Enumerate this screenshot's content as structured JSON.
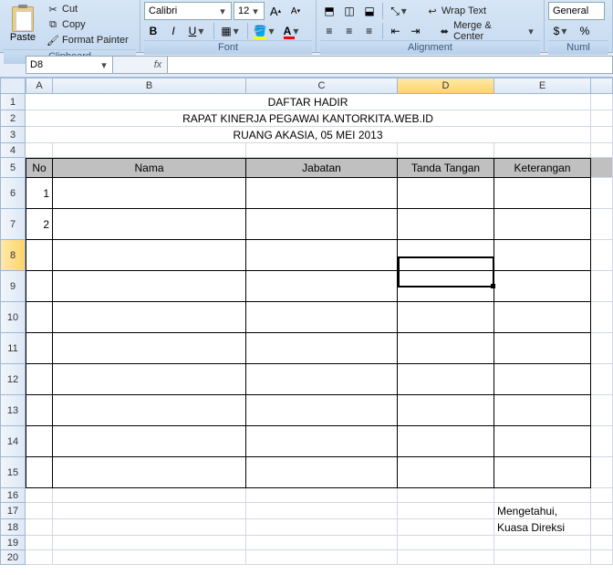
{
  "ribbon": {
    "clipboard": {
      "paste": "Paste",
      "cut": "Cut",
      "copy": "Copy",
      "fmt": "Format Painter",
      "title": "Clipboard"
    },
    "font": {
      "name": "Calibri",
      "size": "12",
      "title": "Font",
      "bold": "B",
      "italic": "I",
      "underline": "U",
      "growA": "A",
      "shrinkA": "A"
    },
    "align": {
      "wrap": "Wrap Text",
      "merge": "Merge & Center",
      "title": "Alignment"
    },
    "number": {
      "fmt": "General",
      "title": "Numl"
    }
  },
  "cellref": "D8",
  "cols": [
    "A",
    "B",
    "C",
    "D",
    "E"
  ],
  "sheet": {
    "title": "DAFTAR HADIR",
    "subtitle": "RAPAT KINERJA PEGAWAI KANTORKITA.WEB.ID",
    "location": "RUANG AKASIA, 05 MEI 2013",
    "headers": {
      "no": "No",
      "nama": "Nama",
      "jabatan": "Jabatan",
      "ttd": "Tanda Tangan",
      "ket": "Keterangan"
    },
    "rows": [
      {
        "no": "1",
        "nama": "",
        "jabatan": "",
        "ttd": "",
        "ket": ""
      },
      {
        "no": "2",
        "nama": "",
        "jabatan": "",
        "ttd": "",
        "ket": ""
      },
      {
        "no": "",
        "nama": "",
        "jabatan": "",
        "ttd": "",
        "ket": ""
      },
      {
        "no": "",
        "nama": "",
        "jabatan": "",
        "ttd": "",
        "ket": ""
      },
      {
        "no": "",
        "nama": "",
        "jabatan": "",
        "ttd": "",
        "ket": ""
      },
      {
        "no": "",
        "nama": "",
        "jabatan": "",
        "ttd": "",
        "ket": ""
      },
      {
        "no": "",
        "nama": "",
        "jabatan": "",
        "ttd": "",
        "ket": ""
      },
      {
        "no": "",
        "nama": "",
        "jabatan": "",
        "ttd": "",
        "ket": ""
      },
      {
        "no": "",
        "nama": "",
        "jabatan": "",
        "ttd": "",
        "ket": ""
      },
      {
        "no": "",
        "nama": "",
        "jabatan": "",
        "ttd": "",
        "ket": ""
      }
    ],
    "sign1": "Mengetahui,",
    "sign2": "Kuasa Direksi"
  }
}
